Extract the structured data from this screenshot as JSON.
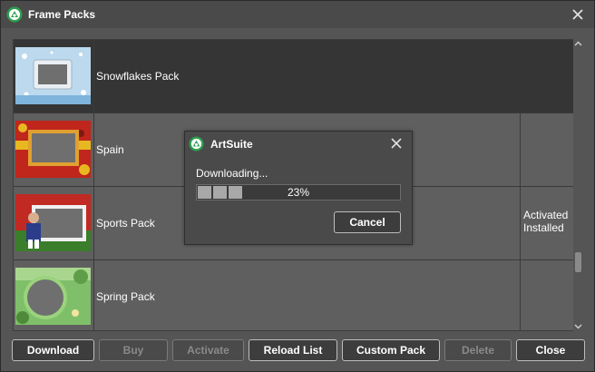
{
  "window": {
    "title": "Frame Packs",
    "logo_icon": "artsuite-logo-icon",
    "close_icon": "close-icon"
  },
  "list": {
    "rows": [
      {
        "name": "Snowflakes Pack",
        "status_line1": "",
        "status_line2": "",
        "selected": true
      },
      {
        "name": "Spain",
        "status_line1": "",
        "status_line2": "",
        "selected": false
      },
      {
        "name": "Sports Pack",
        "status_line1": "Activated",
        "status_line2": "Installed",
        "selected": false
      },
      {
        "name": "Spring Pack",
        "status_line1": "",
        "status_line2": "",
        "selected": false
      }
    ]
  },
  "buttons": {
    "download": "Download",
    "buy": "Buy",
    "activate": "Activate",
    "reload_list": "Reload List",
    "custom_pack": "Custom Pack",
    "delete": "Delete",
    "close": "Close"
  },
  "dialog": {
    "title": "ArtSuite",
    "status": "Downloading...",
    "progress_text": "23%",
    "progress": 0.23,
    "cancel": "Cancel"
  },
  "colors": {
    "background": "#555555",
    "selected_row": "#353535",
    "logo_green": "#2e9e4f"
  }
}
